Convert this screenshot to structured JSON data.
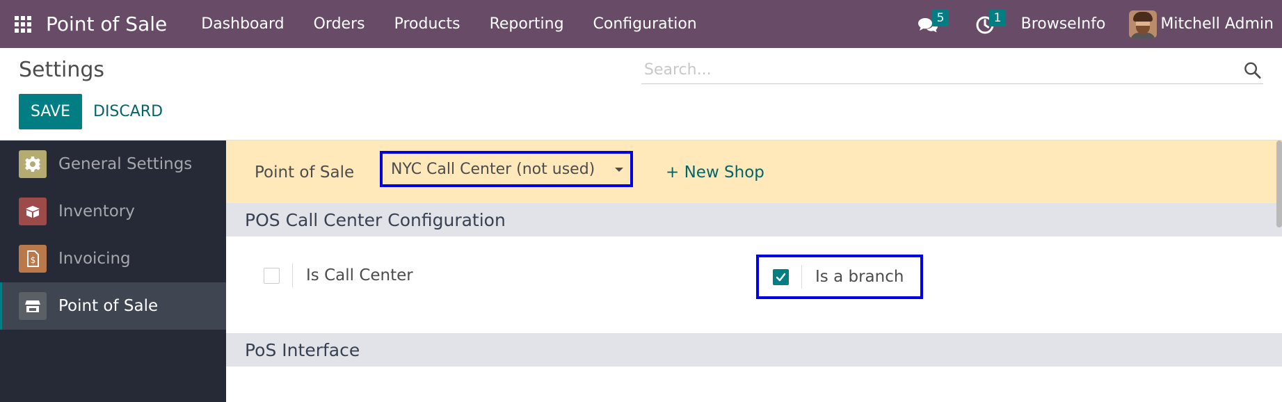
{
  "navbar": {
    "app_title": "Point of Sale",
    "menu": [
      "Dashboard",
      "Orders",
      "Products",
      "Reporting",
      "Configuration"
    ],
    "messages_count": "5",
    "activities_count": "1",
    "company": "BrowseInfo",
    "user_name": "Mitchell Admin"
  },
  "control_panel": {
    "title": "Settings",
    "save_label": "SAVE",
    "discard_label": "DISCARD",
    "search_placeholder": "Search..."
  },
  "sidebar": {
    "items": [
      {
        "label": "General Settings",
        "icon": "gear-icon",
        "color": "#b3ab6f",
        "active": false
      },
      {
        "label": "Inventory",
        "icon": "box-icon",
        "color": "#9c4a4a",
        "active": false
      },
      {
        "label": "Invoicing",
        "icon": "invoice-icon",
        "color": "#b9794a",
        "active": false
      },
      {
        "label": "Point of Sale",
        "icon": "store-icon",
        "color": "#5b5f66",
        "active": true
      }
    ]
  },
  "main": {
    "pos_label": "Point of Sale",
    "selected_shop": "NYC Call Center (not used)",
    "new_shop_label": "+ New Shop",
    "sections": [
      {
        "title": "POS Call Center Configuration",
        "settings": [
          {
            "label": "Is Call Center",
            "checked": false
          },
          {
            "label": "Is a branch",
            "checked": true
          }
        ]
      },
      {
        "title": "PoS Interface"
      }
    ]
  },
  "colors": {
    "navbar": "#684c67",
    "primary": "#017e84",
    "highlight_border": "#0000e6",
    "pos_bar": "#ffe9ba",
    "sidebar": "#262a36"
  }
}
